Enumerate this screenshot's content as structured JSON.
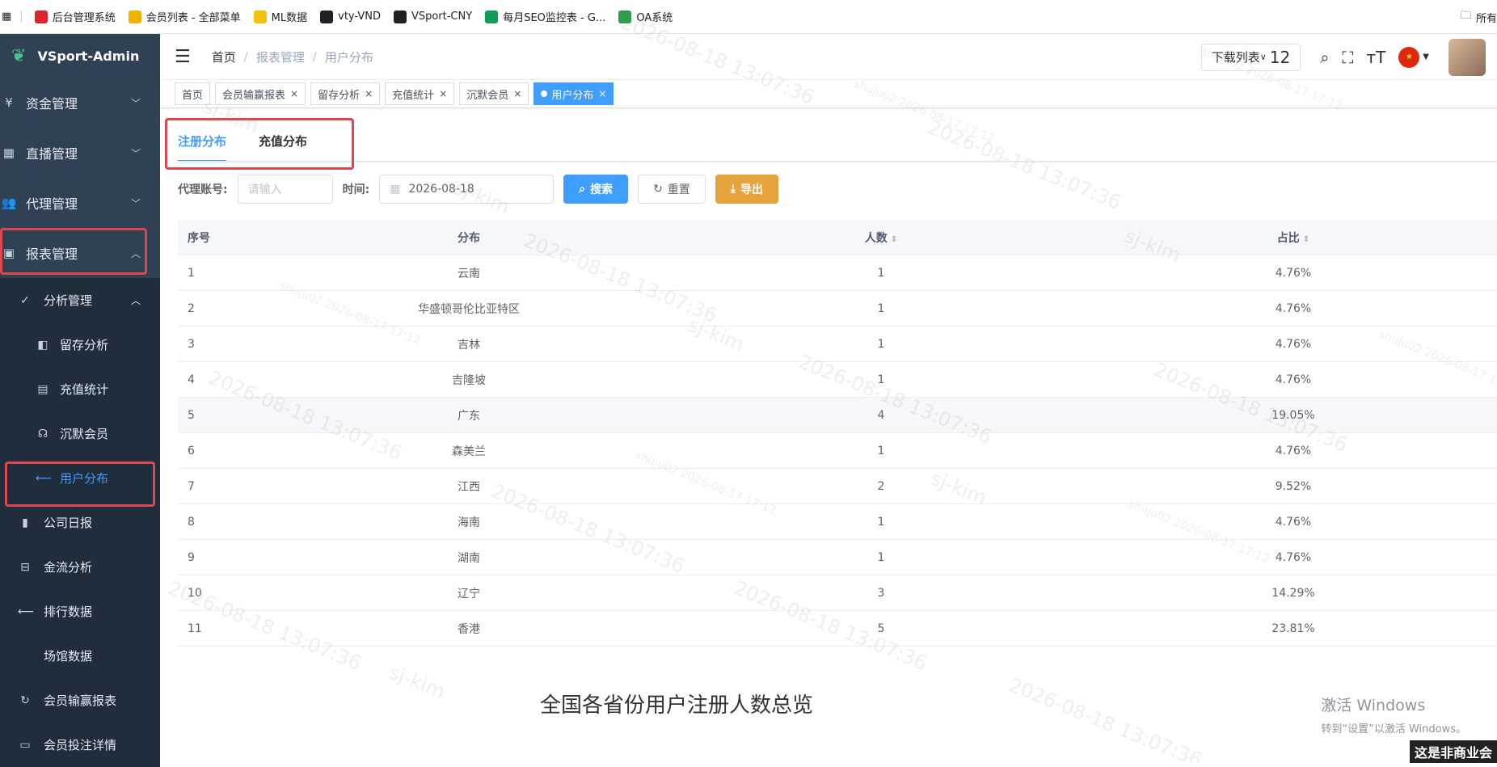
{
  "bookmarks": {
    "items": [
      {
        "label": "后台管理系统",
        "color": "#e0242d"
      },
      {
        "label": "会员列表 - 全部菜单",
        "color": "#f0b400"
      },
      {
        "label": "ML数据",
        "color": "#f4c20d"
      },
      {
        "label": "vty-VND",
        "color": "#202124"
      },
      {
        "label": "VSport-CNY",
        "color": "#202124"
      },
      {
        "label": "每月SEO监控表 - G...",
        "color": "#0f9d58"
      },
      {
        "label": "OA系统",
        "color": "#2e9e4a"
      }
    ],
    "right_label": "所有"
  },
  "sidebar": {
    "logo": "VSport-Admin",
    "menus": [
      {
        "label": "资金管理",
        "icon": "¥"
      },
      {
        "label": "直播管理",
        "icon": "▦"
      },
      {
        "label": "代理管理",
        "icon": "👥"
      },
      {
        "label": "报表管理",
        "icon": "▣"
      }
    ],
    "sub_group": {
      "label": "分析管理",
      "icon": "✓"
    },
    "sub_items": [
      {
        "label": "留存分析",
        "icon": "◧"
      },
      {
        "label": "充值统计",
        "icon": "▤"
      },
      {
        "label": "沉默会员",
        "icon": "☊"
      },
      {
        "label": "用户分布",
        "icon": "⟵"
      }
    ],
    "other_items": [
      {
        "label": "公司日报",
        "icon": "▮"
      },
      {
        "label": "金流分析",
        "icon": "⊟"
      },
      {
        "label": "排行数据",
        "icon": "⟵"
      },
      {
        "label": "场馆数据",
        "icon": ""
      },
      {
        "label": "会员输赢报表",
        "icon": "↻"
      },
      {
        "label": "会员投注详情",
        "icon": "▭"
      }
    ]
  },
  "navbar": {
    "breadcrumb": [
      "首页",
      "报表管理",
      "用户分布"
    ],
    "download_label": "下载列表",
    "download_count": "12"
  },
  "tags": [
    {
      "label": "首页",
      "closable": false,
      "active": false
    },
    {
      "label": "会员输赢报表",
      "closable": true,
      "active": false
    },
    {
      "label": "留存分析",
      "closable": true,
      "active": false
    },
    {
      "label": "充值统计",
      "closable": true,
      "active": false
    },
    {
      "label": "沉默会员",
      "closable": true,
      "active": false
    },
    {
      "label": "用户分布",
      "closable": true,
      "active": true
    }
  ],
  "tabs": [
    "注册分布",
    "充值分布"
  ],
  "filter": {
    "agent_label": "代理账号:",
    "agent_placeholder": "请输入",
    "time_label": "时间:",
    "date_value": "2026-08-18",
    "search_label": "搜索",
    "reset_label": "重置",
    "export_label": "导出"
  },
  "table": {
    "headers": [
      "序号",
      "分布",
      "人数",
      "占比"
    ],
    "rows": [
      [
        "1",
        "云南",
        "1",
        "4.76%"
      ],
      [
        "2",
        "华盛顿哥伦比亚特区",
        "1",
        "4.76%"
      ],
      [
        "3",
        "吉林",
        "1",
        "4.76%"
      ],
      [
        "4",
        "吉隆坡",
        "1",
        "4.76%"
      ],
      [
        "5",
        "广东",
        "4",
        "19.05%"
      ],
      [
        "6",
        "森美兰",
        "1",
        "4.76%"
      ],
      [
        "7",
        "江西",
        "2",
        "9.52%"
      ],
      [
        "8",
        "海南",
        "1",
        "4.76%"
      ],
      [
        "9",
        "湖南",
        "1",
        "4.76%"
      ],
      [
        "10",
        "辽宁",
        "3",
        "14.29%"
      ],
      [
        "11",
        "香港",
        "5",
        "23.81%"
      ]
    ]
  },
  "map_title": "全国各省份用户注册人数总览",
  "windows_activation": {
    "line1": "激活 Windows",
    "line2": "转到“设置”以激活 Windows。"
  },
  "corner_text": "这是非商业会",
  "watermark": [
    "2026-08-18 13:07:36",
    "sj-kim",
    "shuju02 2026-08-17 17:12"
  ],
  "colors": {
    "primary": "#409eff",
    "warning": "#e6a23c",
    "sidebar": "#304156",
    "highlight": "#e0464e"
  }
}
